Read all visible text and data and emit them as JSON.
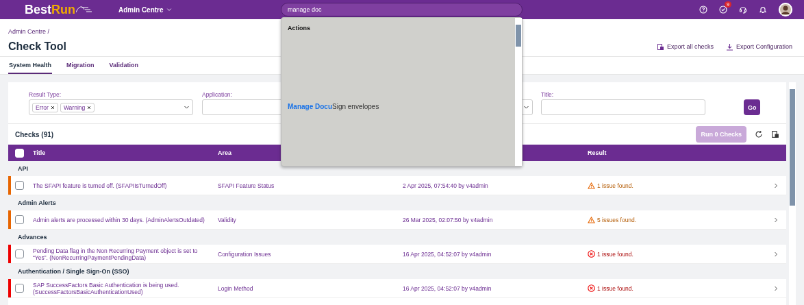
{
  "header": {
    "logo": {
      "primary": "Best",
      "accent": "Run"
    },
    "menu": "Admin Centre",
    "search": {
      "value": "manage doc"
    },
    "task_badge": "9"
  },
  "search_results": {
    "heading": "Actions",
    "items": [
      "**Manage Docu**Sign envelopes"
    ]
  },
  "breadcrumb": "Admin Centre /",
  "title": "Check Tool",
  "actions": [
    {
      "kind": "export",
      "label": "Export all checks"
    },
    {
      "kind": "download",
      "label": "Export Configuration"
    }
  ],
  "tabs": [
    {
      "label": "System Health",
      "selected": true
    },
    {
      "label": "Migration",
      "selected": false
    },
    {
      "label": "Validation",
      "selected": false
    }
  ],
  "filters": {
    "result_type": {
      "label": "Result Type:",
      "tokens": [
        "Error",
        "Warning"
      ]
    },
    "application": {
      "label": "Application:"
    },
    "title": {
      "label": "Title:"
    },
    "go": "Go"
  },
  "checks": {
    "heading": "Checks (91)",
    "run_button": {
      "label": "Run 0 Checks",
      "disabled": true
    },
    "select_all": {
      "checked": false
    },
    "columns": [
      "Title",
      "Area",
      "Result"
    ],
    "groups": [
      {
        "name": "API",
        "rows": [
          {
            "title": "The SFAPI feature is turned off. (SFAPIIsTurnedOff)",
            "area": "SFAPI Feature Status",
            "last_run": "2 Apr 2025, 07:54:40 by v4admin",
            "result": "1 issue found.",
            "kind": "warning",
            "checked": false
          }
        ]
      },
      {
        "name": "Admin Alerts",
        "rows": [
          {
            "title": "Admin alerts are processed within 30 days. (AdminAlertsOutdated)",
            "area": "Validity",
            "last_run": "26 Mar 2025, 02:07:50 by v4admin",
            "result": "5 issues found.",
            "kind": "warning",
            "checked": false
          }
        ]
      },
      {
        "name": "Advances",
        "rows": [
          {
            "title": "Pending Data flag in the Non Recurring Payment object is set to “Yes”. (NonRecurringPaymentPendingData)",
            "area": "Configuration Issues",
            "last_run": "16 Apr 2025, 04:52:07 by v4admin",
            "result": "1 issue found.",
            "kind": "error",
            "checked": false
          }
        ]
      },
      {
        "name": "Authentication / Single Sign-On (SSO)",
        "rows": [
          {
            "title": "SAP SuccessFactors Basic Authentication is being used. (SuccessFactorsBasicAuthenticationUsed)",
            "area": "Login Method",
            "last_run": "16 Apr 2025, 04:52:07 by v4admin",
            "result": "1 issue found.",
            "kind": "error",
            "checked": false
          }
        ]
      }
    ]
  }
}
